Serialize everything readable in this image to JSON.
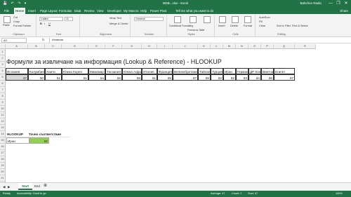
{
  "window": {
    "title": "MDB...xlsx - Excel",
    "user": "Bahchev Radio",
    "qat": "💾 ↶ ↷ ▾",
    "controls": [
      "—",
      "❐",
      "✕"
    ]
  },
  "ribbon_tabs": [
    "File",
    "Home",
    "Insert",
    "Page Layout",
    "Formulas",
    "Data",
    "Review",
    "View",
    "Developer",
    "My Macros",
    "Help",
    "Power Pivot"
  ],
  "active_tab": "Home",
  "tell_me": "Tell me what you want to do",
  "share": "Share",
  "ribbon": {
    "clipboard": {
      "paste": "Paste",
      "cut": "Cut",
      "copy": "Copy",
      "format_painter": "Format Painter",
      "label": "Clipboard"
    },
    "font": {
      "name": "Calibri",
      "size": "11",
      "bold": "B",
      "italic": "I",
      "underline": "U",
      "label": "Font"
    },
    "alignment": {
      "wrap": "Wrap Text",
      "merge": "Merge & Center",
      "label": "Alignment"
    },
    "number": {
      "format": "General",
      "label": "Number"
    },
    "styles": {
      "conditional": "Conditional Formatting",
      "table": "Format as Table",
      "cell_styles": "Cell Styles",
      "label": "Styles"
    },
    "cells": {
      "insert": "Insert",
      "delete": "Delete",
      "format": "Format",
      "label": "Cells"
    },
    "editing": {
      "autosum": "AutoSum",
      "fill": "Fill",
      "clear": "Clear",
      "sort": "Sort & Filter",
      "find": "Find & Select",
      "label": "Editing"
    }
  },
  "formula_bar": {
    "name_box": "A3",
    "fx": "fx",
    "content": "Испания"
  },
  "columns": [
    "A",
    "B",
    "C",
    "D",
    "E",
    "F",
    "G",
    "H",
    "I",
    "J",
    "K",
    "L",
    "M",
    "N",
    "O",
    "P",
    "Q",
    "R"
  ],
  "rows": [
    "1",
    "2",
    "3",
    "4",
    "5",
    "6",
    "7",
    "8",
    "9",
    "10",
    "11",
    "12",
    "13",
    "14",
    "15",
    "16",
    "17",
    "18",
    "19",
    "20",
    "21",
    "22"
  ],
  "sheet_title": "Формули за извличане на информация (Lookup & Reference) - HLOOKUP",
  "table": {
    "countries": [
      "Испания",
      "Колумбия",
      "Хаити",
      "Южна Корея",
      "Мианмар",
      "Танзания",
      "Южна Африка",
      "Италия",
      "Франция",
      "Великобритания",
      "Тайланд",
      "Турция",
      "Иран",
      "Германия",
      "ДР Конго",
      "Виетнам",
      "Египет"
    ],
    "values": [
      "47",
      "50",
      "51",
      "51",
      "54",
      "56",
      "58",
      "61",
      "65",
      "67",
      "69",
      "82",
      "82",
      "83",
      "84",
      "96",
      "97"
    ]
  },
  "hlookup_label": "HLOOKUP",
  "exact_match_label": "Точно съответствие",
  "lookup_key": "Иран",
  "lookup_result": "82",
  "sheets": [
    "Start",
    "End"
  ],
  "status": {
    "ready": "Ready",
    "accessibility": "Accessibility: Good to go",
    "average": "Average: 47",
    "count": "Count: 2",
    "sum": "Sum: 47",
    "zoom": "100%"
  }
}
